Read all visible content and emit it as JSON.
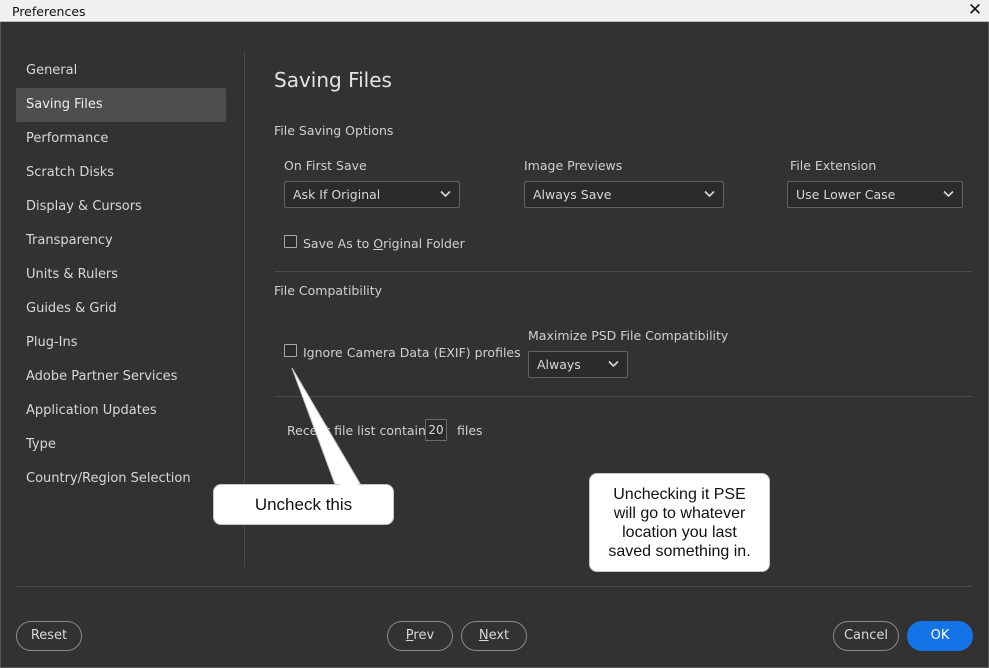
{
  "window": {
    "title": "Preferences",
    "close_glyph": "✕"
  },
  "sidebar": {
    "items": [
      {
        "label": "General"
      },
      {
        "label": "Saving Files",
        "active": true
      },
      {
        "label": "Performance"
      },
      {
        "label": "Scratch Disks"
      },
      {
        "label": "Display & Cursors"
      },
      {
        "label": "Transparency"
      },
      {
        "label": "Units & Rulers"
      },
      {
        "label": "Guides & Grid"
      },
      {
        "label": "Plug-Ins"
      },
      {
        "label": "Adobe Partner Services"
      },
      {
        "label": "Application Updates"
      },
      {
        "label": "Type"
      },
      {
        "label": "Country/Region Selection"
      }
    ]
  },
  "main": {
    "heading": "Saving Files",
    "file_saving_options": {
      "section_label": "File Saving Options",
      "on_first_save": {
        "label": "On First Save",
        "value": "Ask If Original"
      },
      "image_previews": {
        "label": "Image Previews",
        "value": "Always Save"
      },
      "file_extension": {
        "label": "File Extension",
        "value": "Use Lower Case"
      },
      "save_as_original": {
        "label_pre": "Save As to ",
        "label_mnemonic": "O",
        "label_post": "riginal Folder",
        "checked": false
      }
    },
    "file_compatibility": {
      "section_label": "File Compatibility",
      "ignore_exif": {
        "label": "Ignore Camera Data (EXIF) profiles",
        "checked": false
      },
      "maximize_psd": {
        "label": "Maximize PSD File Compatibility",
        "value": "Always"
      }
    },
    "recent_files": {
      "label_pre": "Recent file list contains",
      "value": "20",
      "label_post": "files"
    }
  },
  "footer": {
    "reset_label": "Reset",
    "prev_mnemonic": "P",
    "prev_rest": "rev",
    "next_mnemonic": "N",
    "next_rest": "ext",
    "cancel_label": "Cancel",
    "ok_label": "OK"
  },
  "annotations": {
    "uncheck_callout": "Uncheck this",
    "info_callout_lines": [
      "Unchecking it PSE",
      "will go to whatever",
      "location you last",
      "saved something in."
    ]
  },
  "colors": {
    "background": "#323232",
    "active_item": "#4e4e4e",
    "primary_button": "#1473e6",
    "callout": "#ffffff"
  },
  "icons": {
    "dropdown": "chevron-down-icon",
    "close": "close-icon"
  }
}
